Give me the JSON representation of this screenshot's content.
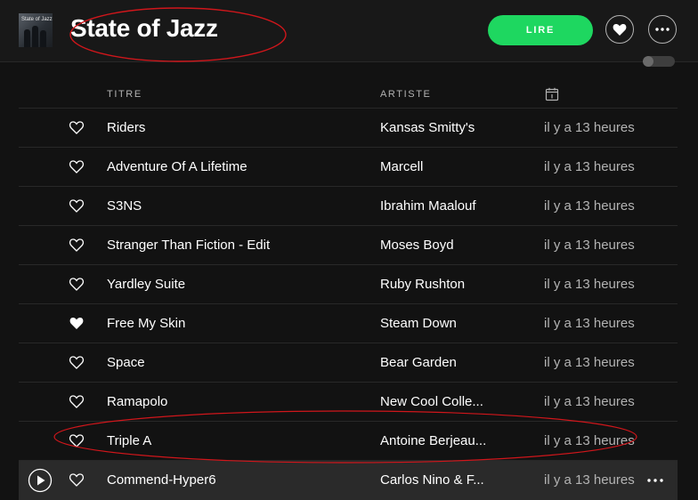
{
  "playlist": {
    "title": "State of Jazz",
    "cover_text": "State of Jazz"
  },
  "header": {
    "play_label": "LIRE",
    "icons": [
      "heart-icon",
      "more-icon"
    ],
    "accent_color": "#1ed760"
  },
  "columns": {
    "title": "TITRE",
    "artist": "ARTISTE",
    "date_icon": "calendar-icon"
  },
  "tracks": [
    {
      "title": "Riders",
      "artist": "Kansas Smitty's",
      "added": "il y a 13 heures",
      "liked": false
    },
    {
      "title": "Adventure Of A Lifetime",
      "artist": "Marcell",
      "added": "il y a 13 heures",
      "liked": false
    },
    {
      "title": "S3NS",
      "artist": "Ibrahim Maalouf",
      "added": "il y a 13 heures",
      "liked": false
    },
    {
      "title": "Stranger Than Fiction - Edit",
      "artist": "Moses Boyd",
      "added": "il y a 13 heures",
      "liked": false
    },
    {
      "title": "Yardley Suite",
      "artist": "Ruby Rushton",
      "added": "il y a 13 heures",
      "liked": false
    },
    {
      "title": "Free My Skin",
      "artist": "Steam Down",
      "added": "il y a 13 heures",
      "liked": true
    },
    {
      "title": "Space",
      "artist": "Bear Garden",
      "added": "il y a 13 heures",
      "liked": false
    },
    {
      "title": "Ramapolo",
      "artist": "New Cool Colle...",
      "added": "il y a 13 heures",
      "liked": false
    },
    {
      "title": "Triple A",
      "artist": "Antoine Berjeau...",
      "added": "il y a 13 heures",
      "liked": false
    },
    {
      "title": "Commend-Hyper6",
      "artist": "Carlos Nino & F...",
      "added": "il y a 13 heures",
      "liked": false,
      "hovered": true
    }
  ],
  "annotation_color": "#d0161b"
}
